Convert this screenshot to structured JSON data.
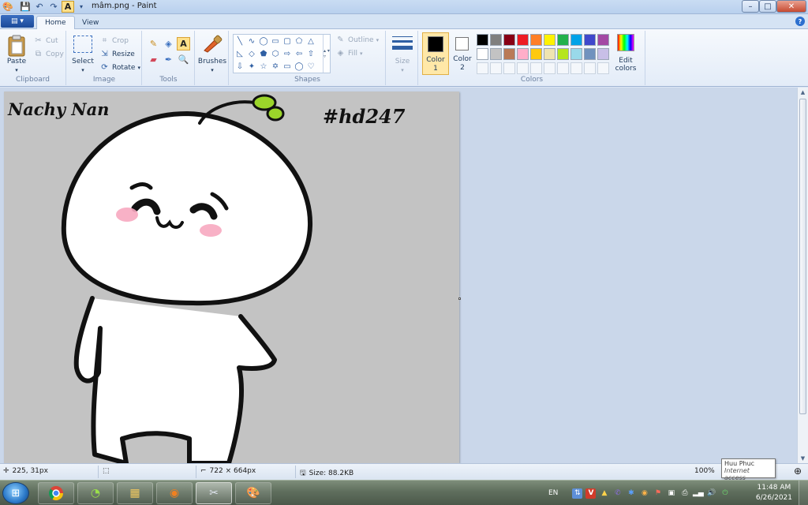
{
  "window": {
    "title": "mâm.png - Paint",
    "quick_access": [
      "paint-icon",
      "save-icon",
      "undo-icon",
      "redo-icon",
      "text-icon"
    ],
    "controls": {
      "minimize": "–",
      "maximize": "□",
      "close": "✕"
    }
  },
  "tabs": {
    "menu_button": "▤ ▾",
    "items": [
      {
        "label": "Home",
        "active": true
      },
      {
        "label": "View",
        "active": false
      }
    ],
    "help": "?"
  },
  "ribbon": {
    "clipboard": {
      "paste": "Paste",
      "cut": "Cut",
      "copy": "Copy",
      "label": "Clipboard"
    },
    "image": {
      "select": "Select",
      "crop": "Crop",
      "resize": "Resize",
      "rotate": "Rotate",
      "label": "Image"
    },
    "tools": {
      "label": "Tools",
      "items": [
        "pencil-icon",
        "fill-icon",
        "text-icon",
        "eraser-icon",
        "color-picker-icon",
        "magnifier-icon"
      ]
    },
    "brushes": {
      "label": "Brushes"
    },
    "shapes": {
      "label": "Shapes",
      "outline": "Outline",
      "fill": "Fill"
    },
    "size": {
      "label": "Size"
    },
    "colors": {
      "color1_label": "Color",
      "color1_num": "1",
      "color2_label": "Color",
      "color2_num": "2",
      "edit": "Edit colors",
      "label": "Colors",
      "color1": "#000000",
      "color2": "#ffffff",
      "palette_row1": [
        "#000000",
        "#7f7f7f",
        "#880015",
        "#ed1c24",
        "#ff7f27",
        "#fff200",
        "#22b14c",
        "#00a2e8",
        "#3f48cc",
        "#a349a4"
      ],
      "palette_row2": [
        "#ffffff",
        "#c3c3c3",
        "#b97a57",
        "#ffaec9",
        "#ffc90e",
        "#efe4b0",
        "#b5e61d",
        "#99d9ea",
        "#7092be",
        "#c8bfe7"
      ]
    }
  },
  "canvas": {
    "signature": "Nachy Nan",
    "hashtag": "#hd247"
  },
  "status": {
    "cursor": "225, 31px",
    "dimensions": "722 × 664px",
    "size": "Size: 88.2KB",
    "zoom": "100%"
  },
  "tooltip": {
    "title": "Huu Phuc",
    "subtitle": "Internet access"
  },
  "taskbar": {
    "apps": [
      "chrome-icon",
      "greenshot-icon",
      "explorer-icon",
      "avast-icon",
      "snipping-tool-icon",
      "paint-icon"
    ],
    "language": "EN",
    "time": "11:48 AM",
    "date": "6/26/2021"
  }
}
